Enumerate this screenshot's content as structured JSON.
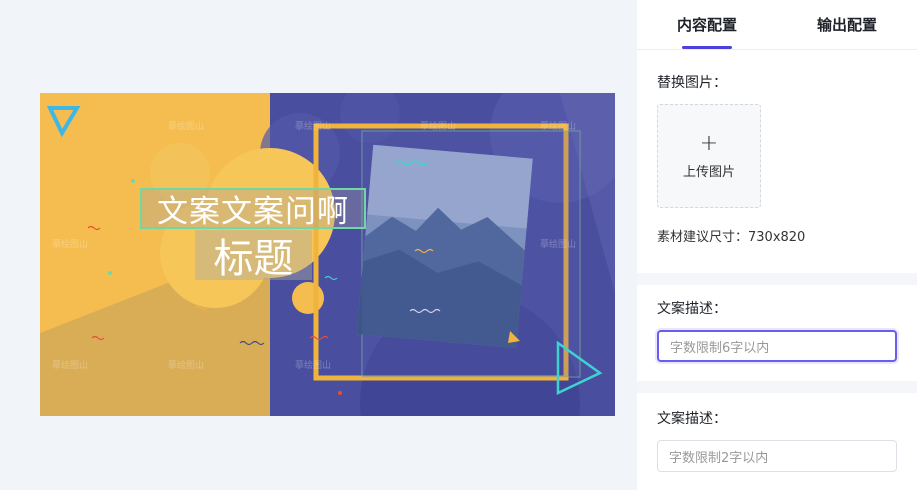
{
  "tabs": [
    {
      "label": "内容配置",
      "active": true
    },
    {
      "label": "输出配置",
      "active": false
    }
  ],
  "replace_image": {
    "label": "替换图片：",
    "upload_label": "上传图片",
    "hint": "素材建议尺寸：730x820"
  },
  "fields": [
    {
      "label": "文案描述：",
      "placeholder": "字数限制6字以内",
      "focused": true
    },
    {
      "label": "文案描述：",
      "placeholder": "字数限制2字以内",
      "focused": false
    }
  ],
  "banner": {
    "main_text": "文案文案问啊",
    "sub_text": "标题",
    "watermark": "摹绘图山"
  },
  "colors": {
    "accent": "#4a3fe0",
    "banner_yellow": "#f5bd4f",
    "banner_blue": "#4b4f9f",
    "frame": "#f0b43c",
    "selection": "#6fd8a5"
  }
}
